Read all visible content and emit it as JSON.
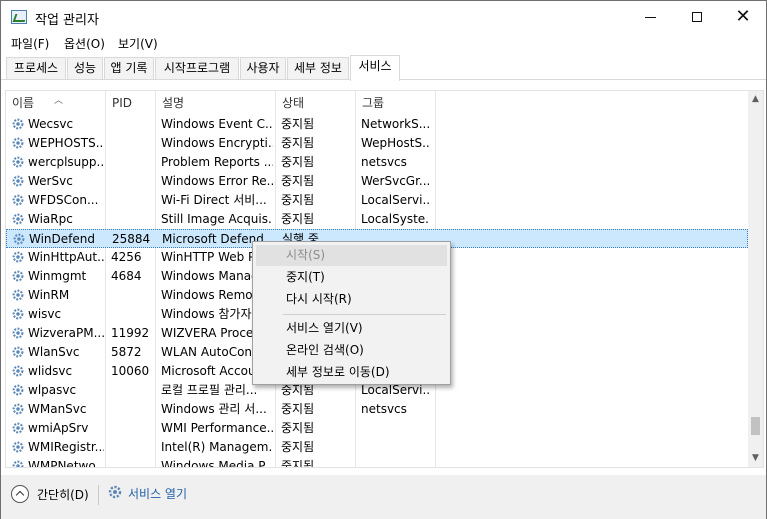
{
  "window": {
    "title": "작업 관리자",
    "minimize": "─",
    "maximize": "☐",
    "close": "✕"
  },
  "menu": [
    "파일(F)",
    "옵션(O)",
    "보기(V)"
  ],
  "tabs": [
    "프로세스",
    "성능",
    "앱 기록",
    "시작프로그램",
    "사용자",
    "세부 정보",
    "서비스"
  ],
  "active_tab": "서비스",
  "columns": [
    "이름",
    "PID",
    "설명",
    "상태",
    "그룹"
  ],
  "rows": [
    {
      "name": "Wecsvc",
      "pid": "",
      "desc": "Windows Event C...",
      "status": "중지됨",
      "group": "NetworkS..."
    },
    {
      "name": "WEPHOSTS...",
      "pid": "",
      "desc": "Windows Encrypti...",
      "status": "중지됨",
      "group": "WepHostS..."
    },
    {
      "name": "wercplsupp...",
      "pid": "",
      "desc": "Problem Reports ...",
      "status": "중지됨",
      "group": "netsvcs"
    },
    {
      "name": "WerSvc",
      "pid": "",
      "desc": "Windows Error Re...",
      "status": "중지됨",
      "group": "WerSvcGr..."
    },
    {
      "name": "WFDSCon...",
      "pid": "",
      "desc": "Wi-Fi Direct 서비...",
      "status": "중지됨",
      "group": "LocalServi..."
    },
    {
      "name": "WiaRpc",
      "pid": "",
      "desc": "Still Image Acquis...",
      "status": "중지됨",
      "group": "LocalSyste..."
    },
    {
      "name": "WinDefend",
      "pid": "25884",
      "desc": "Microsoft Defend",
      "status": "실행 중",
      "group": ""
    },
    {
      "name": "WinHttpAut...",
      "pid": "4256",
      "desc": "WinHTTP Web Pr",
      "status": "",
      "group": ""
    },
    {
      "name": "Winmgmt",
      "pid": "4684",
      "desc": "Windows Manag",
      "status": "",
      "group": ""
    },
    {
      "name": "WinRM",
      "pid": "",
      "desc": "Windows Remote",
      "status": "",
      "group": ""
    },
    {
      "name": "wisvc",
      "pid": "",
      "desc": "Windows 참가자",
      "status": "",
      "group": ""
    },
    {
      "name": "WizveraPM...",
      "pid": "11992",
      "desc": "WIZVERA Proces",
      "status": "",
      "group": ""
    },
    {
      "name": "WlanSvc",
      "pid": "5872",
      "desc": "WLAN AutoConf",
      "status": "",
      "group": ""
    },
    {
      "name": "wlidsvc",
      "pid": "10060",
      "desc": "Microsoft Accou",
      "status": "",
      "group": ""
    },
    {
      "name": "wlpasvc",
      "pid": "",
      "desc": "로컬 프로필 관리...",
      "status": "중지됨",
      "group": "LocalServi..."
    },
    {
      "name": "WManSvc",
      "pid": "",
      "desc": "Windows 관리 서...",
      "status": "중지됨",
      "group": "netsvcs"
    },
    {
      "name": "wmiApSrv",
      "pid": "",
      "desc": "WMI Performance...",
      "status": "중지됨",
      "group": ""
    },
    {
      "name": "WMIRegistr...",
      "pid": "",
      "desc": "Intel(R) Managem...",
      "status": "중지됨",
      "group": ""
    },
    {
      "name": "WMPNetwo...",
      "pid": "",
      "desc": "Windows Media P...",
      "status": "중지됨",
      "group": ""
    }
  ],
  "selected_row": "WinDefend",
  "context_menu": {
    "start": "시작(S)",
    "stop": "중지(T)",
    "restart": "다시 시작(R)",
    "open_services": "서비스 열기(V)",
    "search_online": "온라인 검색(O)",
    "go_to_details": "세부 정보로 이동(D)"
  },
  "footer": {
    "fewer_details": "간단히(D)",
    "open_services": "서비스 열기"
  },
  "colors": {
    "selection": "#cce8ff",
    "link": "#1f5fa8",
    "gear": "#5a87b8"
  }
}
